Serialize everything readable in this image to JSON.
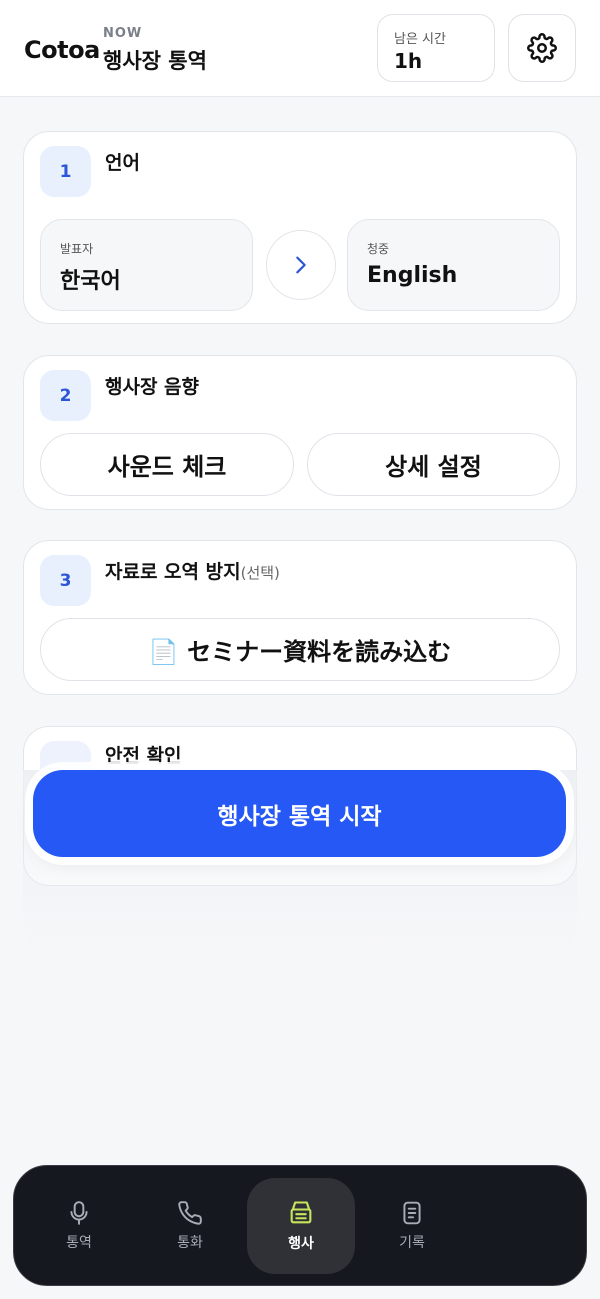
{
  "header": {
    "logo": "Cotoa",
    "now_label": "NOW",
    "mode_title": "행사장 통역",
    "time_label": "남은 시간",
    "time_value": "1h"
  },
  "cards": {
    "language": {
      "step": "1",
      "title": "언어",
      "speaker_label": "발표자",
      "speaker_value": "한국어",
      "audience_label": "청중",
      "audience_value": "English"
    },
    "audio": {
      "step": "2",
      "title": "행사장 음향",
      "sound_check": "사운드 체크",
      "detail_settings": "상세 설정"
    },
    "material": {
      "step": "3",
      "title": "자료로 오역 방지",
      "optional": "(선택)",
      "load_button": "📄 セミナー資料を読み込む"
    },
    "safety": {
      "title": "안전 확인"
    }
  },
  "start_button": "행사장 통역 시작",
  "nav": {
    "items": [
      {
        "label": "통역",
        "icon": "microphone-icon"
      },
      {
        "label": "통화",
        "icon": "phone-icon"
      },
      {
        "label": "행사",
        "icon": "event-icon"
      },
      {
        "label": "기록",
        "icon": "document-icon"
      }
    ],
    "active_index": 2
  },
  "colors": {
    "accent": "#2558f5",
    "step_bg": "#e8effd",
    "active_icon": "#c7e65a",
    "nav_bg": "#16181f"
  }
}
